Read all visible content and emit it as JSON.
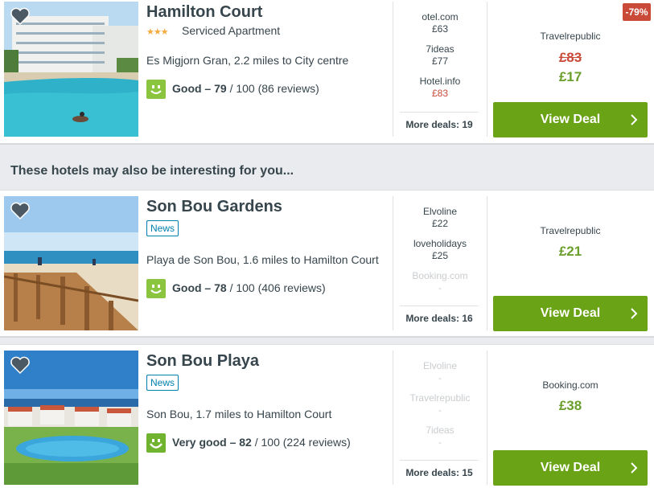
{
  "section_title": "These hotels may also be interesting for you...",
  "colors": {
    "accent_green": "#6aa316",
    "discount_red": "#c94a38",
    "rating_green": "#8bc53f",
    "price_green": "#6a9f2c"
  },
  "hotels": [
    {
      "name": "Hamilton Court",
      "stars": "★★★",
      "star_count": 3,
      "type": "Serviced Apartment",
      "badge": "",
      "location": "Es Migjorn Gran, 2.2 miles to City centre",
      "rating_word": "Good – 79",
      "rating_rest": " / 100 (86 reviews)",
      "rating_icon": "smiley-icon",
      "deals": [
        {
          "site": "otel.com",
          "price": "£63"
        },
        {
          "site": "7ideas",
          "price": "£77"
        },
        {
          "site": "Hotel.info",
          "price": "£83"
        }
      ],
      "more_deals": "More deals: 19",
      "best_site": "Travelrepublic",
      "old_price": "£83",
      "best_price": "£17",
      "discount": "-79%",
      "button": "View Deal"
    },
    {
      "name": "Son Bou Gardens",
      "badge": "News",
      "location": "Playa de Son Bou, 1.6 miles to Hamilton Court",
      "rating_word": "Good – 78",
      "rating_rest": " / 100 (406 reviews)",
      "rating_icon": "smiley-icon",
      "deals": [
        {
          "site": "Elvoline",
          "price": "£22"
        },
        {
          "site": "loveholidays",
          "price": "£25"
        },
        {
          "site": "Booking.com",
          "price": "-"
        }
      ],
      "more_deals": "More deals: 16",
      "best_site": "Travelrepublic",
      "best_price": "£21",
      "button": "View Deal"
    },
    {
      "name": "Son Bou Playa",
      "badge": "News",
      "location": "Son Bou, 1.7 miles to Hamilton Court",
      "rating_word": "Very good – 82",
      "rating_rest": " / 100 (224 reviews)",
      "rating_icon": "smiley-icon",
      "deals": [
        {
          "site": "Elvoline",
          "price": "-"
        },
        {
          "site": "Travelrepublic",
          "price": "-"
        },
        {
          "site": "7ideas",
          "price": "-"
        }
      ],
      "more_deals": "More deals: 15",
      "best_site": "Booking.com",
      "best_price": "£38",
      "button": "View Deal"
    }
  ]
}
